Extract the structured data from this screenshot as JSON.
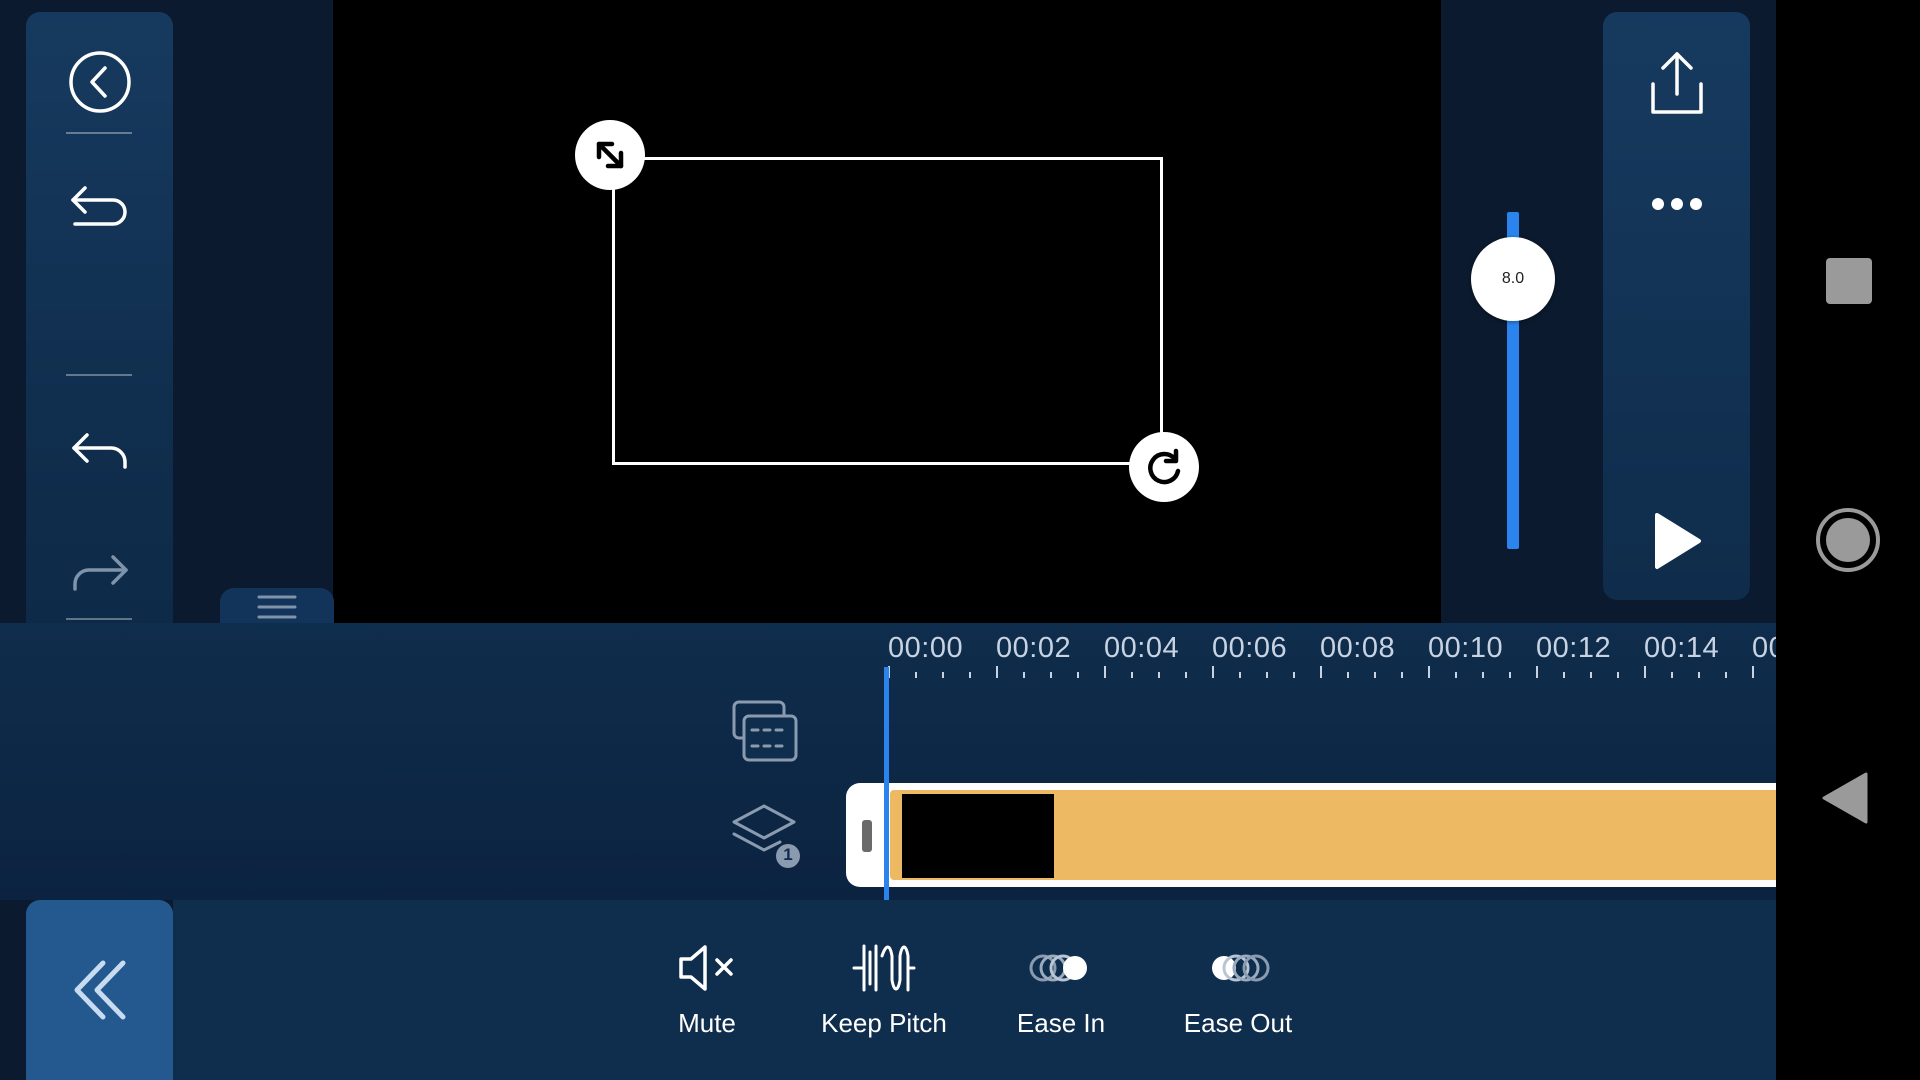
{
  "slider": {
    "value_label": "8.0",
    "level": 0.8
  },
  "timeline": {
    "labels": [
      "00:00",
      "00:02",
      "00:04",
      "00:06",
      "00:08",
      "00:10",
      "00:12",
      "00:14",
      "00"
    ]
  },
  "toolbar": {
    "mute_label": "Mute",
    "keep_pitch_label": "Keep Pitch",
    "ease_in_label": "Ease In",
    "ease_out_label": "Ease Out"
  },
  "layers": {
    "badge": "1"
  },
  "colors": {
    "accent": "#2b84ee",
    "clip": "#edb962",
    "panel": "#12335a",
    "background": "#0b1a2e"
  },
  "icons": {
    "left_panel": [
      "back-circle-icon",
      "undo-return-icon",
      "undo-icon",
      "redo-icon",
      "trash-icon"
    ],
    "right_panel": [
      "share-icon",
      "more-icon",
      "play-icon"
    ],
    "system_nav": [
      "recents-icon",
      "home-icon",
      "back-icon"
    ]
  }
}
